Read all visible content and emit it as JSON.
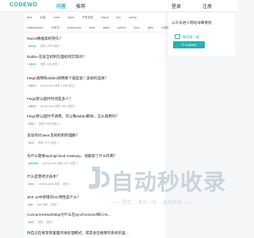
{
  "header": {
    "logo": "CODEWO",
    "nav": [
      "问答",
      "推荐"
    ],
    "login": "登录",
    "register": "注册"
  },
  "tags_row1": [
    "java",
    "后端",
    "node",
    "nginx",
    "开发语言",
    "mysql",
    "jvm",
    "spring"
  ],
  "tags_row2": [
    "elasticsearch",
    "分布式",
    "spring boot",
    "redis",
    "kafka",
    "python",
    "linux",
    "gitee",
    "大数据",
    "查看"
  ],
  "items": [
    {
      "title": "Nacos数据如何持久？",
      "tag": "spring",
      "meta": "查看 10355  回复 1"
    },
    {
      "title": "Dubbo 在安全机制方面如何实现的？",
      "tag": "dubbo",
      "meta": "查看 1000  回复 1"
    },
    {
      "title": "Feign调用和dubbo调用哪个速度高？该如何选择？",
      "tag": "dubbo",
      "meta": "spring cloud  查看 13368  回复 1"
    },
    {
      "title": "Feign默认超时时间是多少？",
      "tag": "dubbo",
      "meta": "spring cloud  查看 15104  回复 1"
    },
    {
      "title": "Feign默认超时不调用，可以像dubbo那样，怎么调用吗？",
      "tag": "feign",
      "meta": "查看 11468  回复 1"
    },
    {
      "title": "谈谈你对Java 反射机制的理解？",
      "tag": "java",
      "meta": "查看 12731  回复 1"
    },
    {
      "title": "为什么需要SpringCloud Gateway，他能帮了什么作用？",
      "tag": "gateway",
      "meta": "spring cloud  查看 10372  回复 1"
    },
    {
      "title": "什么是零拷贝技术？",
      "tag": "linux",
      "meta": "netamg  kafka  查看 ...  回复 1"
    },
    {
      "title": "JDK 11中新增的GC特性是什么？",
      "tag": "jvm",
      "meta": "java  查看 ...  回复 1"
    },
    {
      "title": "ConcurrentHashMap为什么在synchronized和CAS...",
      "tag": "java",
      "meta": "查看 ...  回复 1"
    },
    {
      "title": "你自己在框架新里面的进处理模式，或其会在搜哪作系统的里...",
      "tag": "",
      "meta": ""
    }
  ],
  "sidebar": {
    "title": "公众号进入网站详细要统",
    "wechat_label": "微信搜一搜",
    "button_label": "© codewo"
  },
  "watermark": {
    "big": "自动秒收录",
    "small": "—— 提交 →来访一次 →自动收录 ——"
  }
}
